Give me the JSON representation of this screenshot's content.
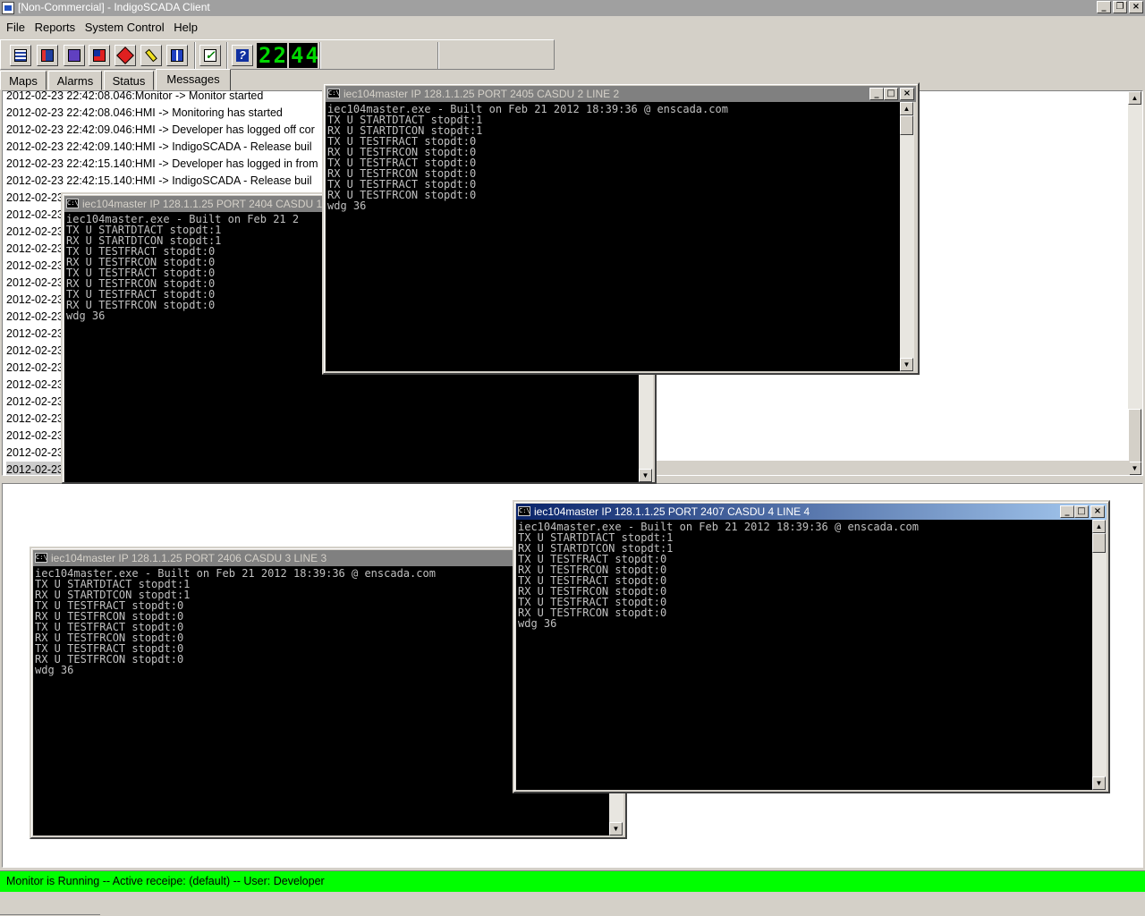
{
  "window": {
    "title": "[Non-Commercial] - IndigoSCADA Client"
  },
  "menu": [
    "File",
    "Reports",
    "System Control",
    "Help"
  ],
  "toolbar": {
    "clock": [
      "22",
      "44"
    ]
  },
  "tabs": [
    "Maps",
    "Alarms",
    "Status",
    "Messages"
  ],
  "messages": [
    "2012-02-23 22:42:08.046:Monitor -> Monitor started",
    "2012-02-23 22:42:08.046:HMI -> Monitoring has started",
    "2012-02-23 22:42:09.046:HMI -> Developer has logged off cor",
    "2012-02-23 22:42:09.140:HMI -> IndigoSCADA - Release buil",
    "2012-02-23 22:42:15.140:HMI -> Developer has logged in from",
    "2012-02-23 22:42:15.140:HMI -> IndigoSCADA - Release buil",
    "2012-02-23",
    "2012-02-23",
    "2012-02-23",
    "2012-02-23",
    "2012-02-23",
    "2012-02-23",
    "2012-02-23",
    "2012-02-23",
    "2012-02-23",
    "2012-02-23",
    "2012-02-23",
    "2012-02-23",
    "2012-02-23",
    "2012-02-23",
    "2012-02-23",
    "2012-02-23",
    "2012-02-23"
  ],
  "consoles": [
    {
      "title": "iec104master IP 128.1.1.25 PORT 2404 CASDU 1",
      "text": "iec104master.exe - Built on Feb 21 2\nTX U STARTDTACT stopdt:1\nRX U STARTDTCON stopdt:1\nTX U TESTFRACT stopdt:0\nRX U TESTFRCON stopdt:0\nTX U TESTFRACT stopdt:0\nRX U TESTFRCON stopdt:0\nTX U TESTFRACT stopdt:0\nRX U TESTFRCON stopdt:0\nwdg 36"
    },
    {
      "title": "iec104master IP 128.1.1.25 PORT 2405 CASDU 2 LINE 2",
      "text": "iec104master.exe - Built on Feb 21 2012 18:39:36 @ enscada.com\nTX U STARTDTACT stopdt:1\nRX U STARTDTCON stopdt:1\nTX U TESTFRACT stopdt:0\nRX U TESTFRCON stopdt:0\nTX U TESTFRACT stopdt:0\nRX U TESTFRCON stopdt:0\nTX U TESTFRACT stopdt:0\nRX U TESTFRCON stopdt:0\nwdg 36"
    },
    {
      "title": "iec104master IP 128.1.1.25 PORT 2406 CASDU 3 LINE 3",
      "text": "iec104master.exe - Built on Feb 21 2012 18:39:36 @ enscada.com\nTX U STARTDTACT stopdt:1\nRX U STARTDTCON stopdt:1\nTX U TESTFRACT stopdt:0\nRX U TESTFRCON stopdt:0\nTX U TESTFRACT stopdt:0\nRX U TESTFRCON stopdt:0\nTX U TESTFRACT stopdt:0\nRX U TESTFRCON stopdt:0\nwdg 36"
    },
    {
      "title": "iec104master IP 128.1.1.25 PORT 2407 CASDU 4 LINE 4",
      "text": "iec104master.exe - Built on Feb 21 2012 18:39:36 @ enscada.com\nTX U STARTDTACT stopdt:1\nRX U STARTDTCON stopdt:1\nTX U TESTFRACT stopdt:0\nRX U TESTFRCON stopdt:0\nTX U TESTFRACT stopdt:0\nRX U TESTFRCON stopdt:0\nTX U TESTFRACT stopdt:0\nRX U TESTFRCON stopdt:0\nwdg 36"
    }
  ],
  "console_icon_label": "C:\\",
  "status": {
    "text": "Monitor is Running -- Active receipe: (default) -- User: Developer",
    "color": "#00ff00"
  },
  "icons": {
    "toolbar": [
      "chart-icon",
      "export-icon",
      "import-icon",
      "config-icon",
      "stop-icon",
      "pen-icon",
      "pause-icon",
      "check-icon",
      "help-icon"
    ]
  },
  "buttons": {
    "minimize": "_",
    "maximize": "□",
    "restore": "❐",
    "close": "×",
    "scroll_up": "▲",
    "scroll_down": "▼"
  }
}
